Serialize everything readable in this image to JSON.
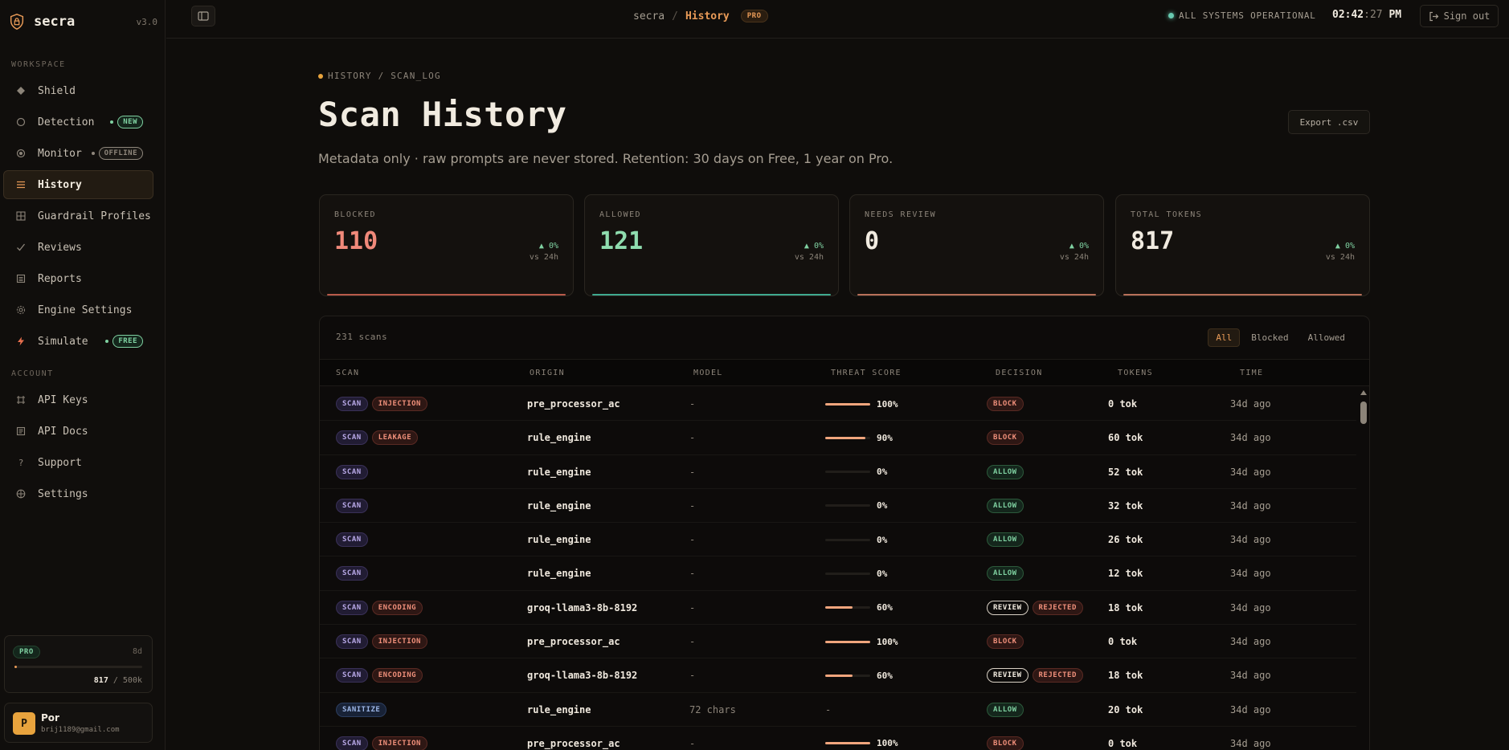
{
  "brand": {
    "name": "secra",
    "version": "v3.0"
  },
  "sidebar": {
    "workspace_label": "WORKSPACE",
    "account_label": "ACCOUNT",
    "workspace": [
      {
        "label": "Shield",
        "icon": "diamond-icon",
        "badge": ""
      },
      {
        "label": "Detection",
        "icon": "circle-icon",
        "badge": "NEW"
      },
      {
        "label": "Monitor",
        "icon": "radio-icon",
        "badge": "OFFLINE"
      },
      {
        "label": "History",
        "icon": "list-icon",
        "badge": ""
      },
      {
        "label": "Guardrail Profiles",
        "icon": "grid-icon",
        "badge": ""
      },
      {
        "label": "Reviews",
        "icon": "check-icon",
        "badge": ""
      },
      {
        "label": "Reports",
        "icon": "report-icon",
        "badge": ""
      },
      {
        "label": "Engine Settings",
        "icon": "gear-icon",
        "badge": ""
      },
      {
        "label": "Simulate",
        "icon": "bolt-icon",
        "badge": "FREE"
      }
    ],
    "account": [
      {
        "label": "API Keys",
        "icon": "key-icon"
      },
      {
        "label": "API Docs",
        "icon": "doc-icon"
      },
      {
        "label": "Support",
        "icon": "question-icon"
      },
      {
        "label": "Settings",
        "icon": "globe-icon"
      }
    ],
    "plan": {
      "badge": "PRO",
      "days": "8d",
      "used": "817",
      "limit": "/ 500k",
      "usage_fraction": 0.0016
    },
    "user": {
      "initial": "P",
      "name": "Por",
      "email": "brij1189@gmail.com"
    }
  },
  "topbar": {
    "crumb_root": "secra",
    "crumb_sep": "/",
    "crumb_current": "History",
    "plan_badge": "PRO",
    "status": "ALL SYSTEMS OPERATIONAL",
    "clock_hm": "02:42",
    "clock_sec": ":27",
    "clock_ampm": " PM",
    "signout": "Sign out"
  },
  "page": {
    "eyebrow": "HISTORY / SCAN_LOG",
    "title": "Scan History",
    "subtitle": "Metadata only · raw prompts are never stored. Retention: 30 days on Free, 1 year on Pro.",
    "export": "Export .csv"
  },
  "stats": [
    {
      "label": "BLOCKED",
      "value": "110",
      "delta": "▲ 0%",
      "vs": "vs 24h",
      "color": "#f0897a",
      "line": "#b85a4a"
    },
    {
      "label": "ALLOWED",
      "value": "121",
      "delta": "▲ 0%",
      "vs": "vs 24h",
      "color": "#8fdcae",
      "line": "#3fa98f"
    },
    {
      "label": "NEEDS REVIEW",
      "value": "0",
      "delta": "▲ 0%",
      "vs": "vs 24h",
      "color": "#f1ebe0",
      "line": "#b8705a"
    },
    {
      "label": "TOTAL TOKENS",
      "value": "817",
      "delta": "▲ 0%",
      "vs": "vs 24h",
      "color": "#f1ebe0",
      "line": "#b8705a"
    }
  ],
  "table": {
    "count": "231 scans",
    "filters": [
      "All",
      "Blocked",
      "Allowed"
    ],
    "active_filter": "All",
    "columns": [
      "SCAN",
      "ORIGIN",
      "MODEL",
      "THREAT SCORE",
      "DECISION",
      "TOKENS",
      "TIME"
    ],
    "rows": [
      {
        "type": "SCAN",
        "tag": "INJECTION",
        "origin": "pre_processor_ac",
        "model": "-",
        "score": 100,
        "score_label": "100%",
        "decision": "BLOCK",
        "extra": "",
        "tokens": "0 tok",
        "time": "34d ago"
      },
      {
        "type": "SCAN",
        "tag": "LEAKAGE",
        "origin": "rule_engine",
        "model": "-",
        "score": 90,
        "score_label": "90%",
        "decision": "BLOCK",
        "extra": "",
        "tokens": "60 tok",
        "time": "34d ago"
      },
      {
        "type": "SCAN",
        "tag": "",
        "origin": "rule_engine",
        "model": "-",
        "score": 0,
        "score_label": "0%",
        "decision": "ALLOW",
        "extra": "",
        "tokens": "52 tok",
        "time": "34d ago"
      },
      {
        "type": "SCAN",
        "tag": "",
        "origin": "rule_engine",
        "model": "-",
        "score": 0,
        "score_label": "0%",
        "decision": "ALLOW",
        "extra": "",
        "tokens": "32 tok",
        "time": "34d ago"
      },
      {
        "type": "SCAN",
        "tag": "",
        "origin": "rule_engine",
        "model": "-",
        "score": 0,
        "score_label": "0%",
        "decision": "ALLOW",
        "extra": "",
        "tokens": "26 tok",
        "time": "34d ago"
      },
      {
        "type": "SCAN",
        "tag": "",
        "origin": "rule_engine",
        "model": "-",
        "score": 0,
        "score_label": "0%",
        "decision": "ALLOW",
        "extra": "",
        "tokens": "12 tok",
        "time": "34d ago"
      },
      {
        "type": "SCAN",
        "tag": "ENCODING",
        "origin": "groq-llama3-8b-8192",
        "model": "-",
        "score": 60,
        "score_label": "60%",
        "decision": "REVIEW",
        "extra": "REJECTED",
        "tokens": "18 tok",
        "time": "34d ago"
      },
      {
        "type": "SCAN",
        "tag": "INJECTION",
        "origin": "pre_processor_ac",
        "model": "-",
        "score": 100,
        "score_label": "100%",
        "decision": "BLOCK",
        "extra": "",
        "tokens": "0 tok",
        "time": "34d ago"
      },
      {
        "type": "SCAN",
        "tag": "ENCODING",
        "origin": "groq-llama3-8b-8192",
        "model": "-",
        "score": 60,
        "score_label": "60%",
        "decision": "REVIEW",
        "extra": "REJECTED",
        "tokens": "18 tok",
        "time": "34d ago"
      },
      {
        "type": "SANITIZE",
        "tag": "",
        "origin": "rule_engine",
        "model": "72 chars",
        "score": null,
        "score_label": "-",
        "decision": "ALLOW",
        "extra": "",
        "tokens": "20 tok",
        "time": "34d ago"
      },
      {
        "type": "SCAN",
        "tag": "INJECTION",
        "origin": "pre_processor_ac",
        "model": "-",
        "score": 100,
        "score_label": "100%",
        "decision": "BLOCK",
        "extra": "",
        "tokens": "0 tok",
        "time": "34d ago"
      }
    ]
  }
}
